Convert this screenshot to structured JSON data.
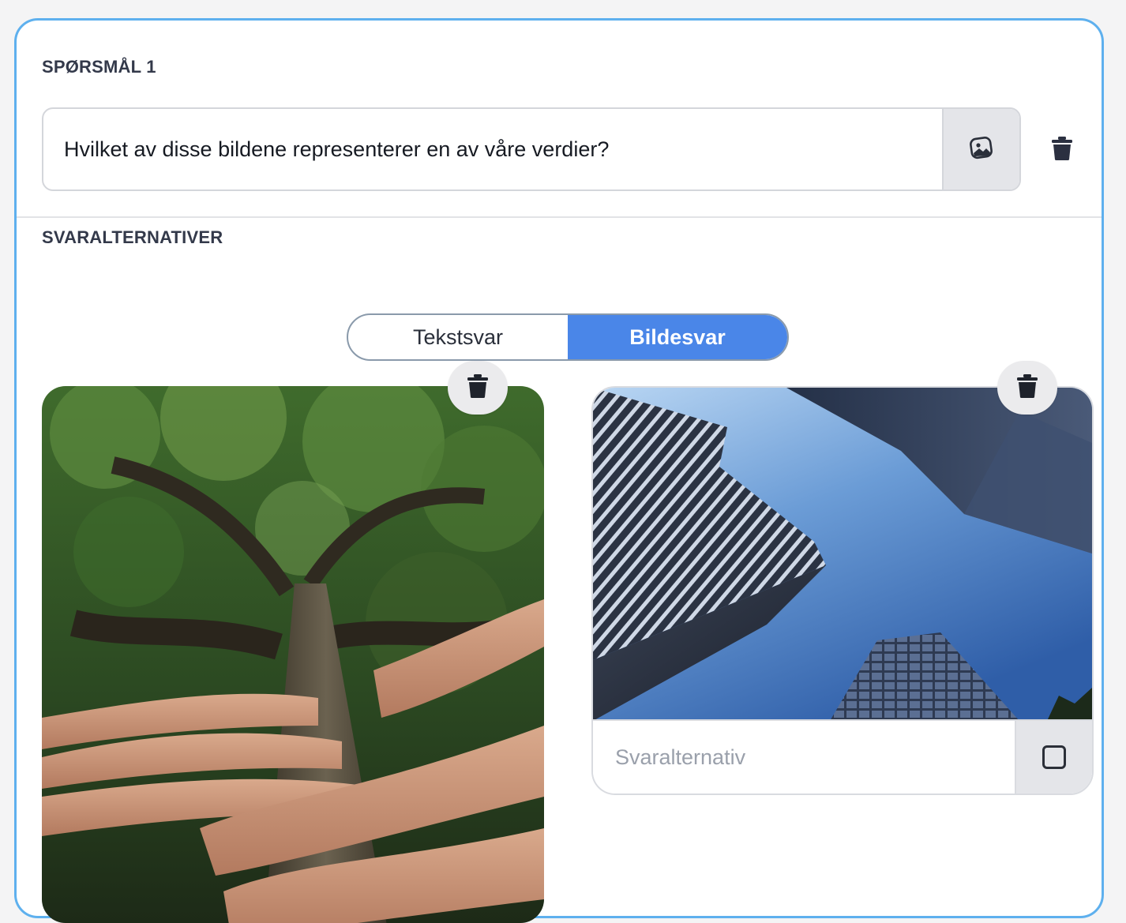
{
  "question": {
    "section_label": "SPØRSMÅL 1",
    "text": "Hvilket av disse bildene representerer en av våre verdier?",
    "image_button_icon": "image-icon",
    "delete_icon": "trash-icon"
  },
  "answers": {
    "section_label": "SVARALTERNATIVER",
    "toggle": {
      "options": [
        "Tekstsvar",
        "Bildesvar"
      ],
      "selected": "Bildesvar",
      "active_color": "#4a86e8"
    },
    "image_options": [
      {
        "image": "hands-on-tree-trunk-photo",
        "delete_icon": "trash-icon"
      },
      {
        "image": "skyscrapers-from-below-photo",
        "placeholder": "Svaralternativ",
        "checked": false,
        "delete_icon": "trash-icon"
      }
    ]
  },
  "colors": {
    "card_border": "#5eb0ee",
    "accent": "#4a86e8"
  }
}
